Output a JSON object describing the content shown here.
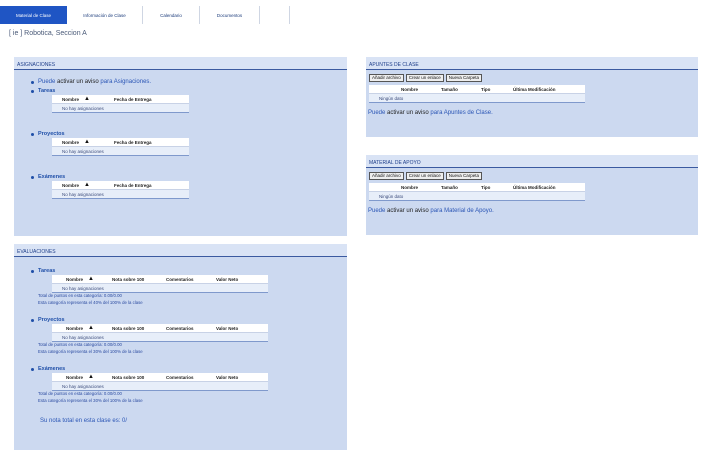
{
  "tabs": [
    {
      "label": "Material de Clase",
      "active": true
    },
    {
      "label": "Información de Clase",
      "active": false
    },
    {
      "label": "Calendario",
      "active": false
    },
    {
      "label": "Documentos",
      "active": false
    }
  ],
  "course_title": "[ ie ] Robotica, Seccion A",
  "asignaciones": {
    "header": "ASIGNACIONES",
    "notice": {
      "prefix": "Puede",
      "action": "activar un aviso",
      "suffix": "para Asignaciones."
    },
    "col_name": "Nombre",
    "col_date": "Fecha de Entrega",
    "empty": "No hay asignaciones",
    "categories": [
      "Tareas",
      "Proyectos",
      "Exámenes"
    ]
  },
  "evaluaciones": {
    "header": "EVALUACIONES",
    "cols": [
      "Nombre",
      "Nota sobre 100",
      "Comentarios",
      "Valor Neto"
    ],
    "empty": "No hay asignaciones",
    "categories": [
      {
        "name": "Tareas",
        "total": "Total de puntos en esta categoría: 0.00/0.00",
        "weight": "Esta categoría representa el 40% del 100% de la clase"
      },
      {
        "name": "Proyectos",
        "total": "Total de puntos en esta categoría: 0.00/0.00",
        "weight": "Esta categoría representa el 30% del 100% de la clase"
      },
      {
        "name": "Exámenes",
        "total": "Total de puntos en esta categoría: 0.00/0.00",
        "weight": "Esta categoría representa el 30% del 100% de la clase"
      }
    ],
    "final": "Su nota total en esta clase es: 0/"
  },
  "apuntes": {
    "header": "APUNTES DE CLASE",
    "buttons": [
      "Añadir archivo",
      "Crear un enlace",
      "Nueva Carpeta"
    ],
    "cols": [
      "Nombre",
      "Tamaño",
      "Tipo",
      "Última Modificación"
    ],
    "empty": "Ningún dato",
    "notice": {
      "prefix": "Puede",
      "action": "activar un aviso",
      "suffix": "para Apuntes de Clase."
    }
  },
  "material": {
    "header": "MATERIAL DE APOYO",
    "buttons": [
      "Añadir archivo",
      "Crear un enlace",
      "Nueva Carpeta"
    ],
    "cols": [
      "Nombre",
      "Tamaño",
      "Tipo",
      "Última Modificación"
    ],
    "empty": "Ningún dato",
    "notice": {
      "prefix": "Puede",
      "action": "activar un aviso",
      "suffix": "para Material de Apoyo."
    }
  },
  "colors": {
    "tab_active": "#1f55c4",
    "panel_bg": "#ccd9f0",
    "header_text": "#1f3f8a"
  }
}
